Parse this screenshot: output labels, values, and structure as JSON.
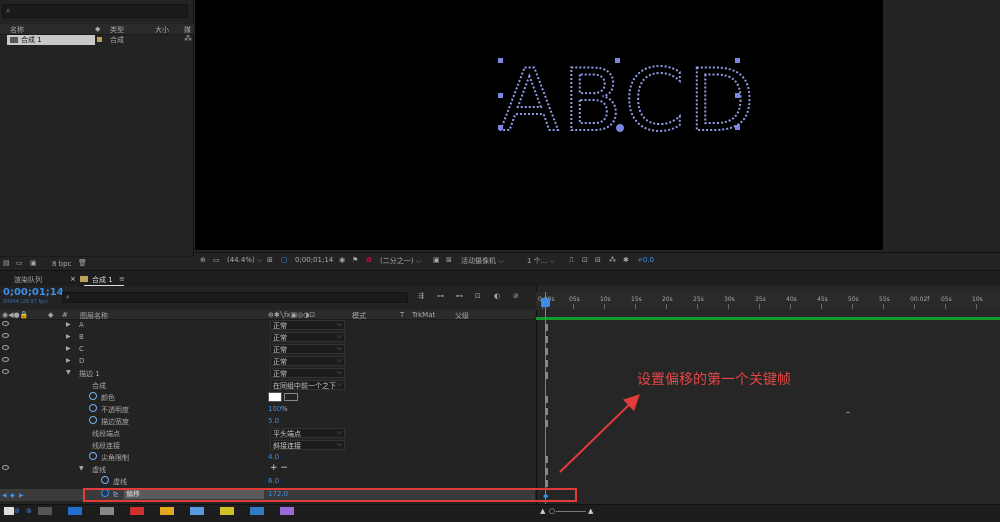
{
  "project": {
    "search_icon": "search-icon",
    "columns": {
      "name": "名称",
      "type": "类型",
      "size": "大小",
      "frame": "媒"
    },
    "item": {
      "name": "合成 1",
      "type": "合成"
    },
    "bpc": "8 bpc"
  },
  "viewer": {
    "zoom": "(44.4%)",
    "timecode": "0;00;01;14",
    "resolution": "(二分之一)",
    "camera": "活动摄像机",
    "views": "1 个...",
    "exposure": "+0.0",
    "letters": "ABCD"
  },
  "timeline": {
    "tab_render": "渲染队列",
    "tab_comp": "合成 1",
    "timecode": "0;00;01;14",
    "fps": "00044 (29.97 fps)",
    "columns": {
      "layer_name": "图层名称",
      "mode": "模式",
      "t": "T",
      "trkmat": "TrkMat",
      "parent": "父级"
    },
    "rows": [
      {
        "name": "A",
        "mode": "正常"
      },
      {
        "name": "B",
        "mode": "正常"
      },
      {
        "name": "C",
        "mode": "正常"
      },
      {
        "name": "D",
        "mode": "正常"
      },
      {
        "name": "描边 1",
        "mode": "正常"
      },
      {
        "name": "合成",
        "mode": "在同组中前一个之下"
      },
      {
        "name": "颜色"
      },
      {
        "name": "不透明度",
        "value": "100",
        "unit": "%"
      },
      {
        "name": "描边宽度",
        "value": "5.0"
      },
      {
        "name": "线段端点",
        "mode": "平头端点"
      },
      {
        "name": "线段连接",
        "mode": "斜接连接"
      },
      {
        "name": "尖角限制",
        "value": "4.0"
      },
      {
        "name": "虚线",
        "plusminus": "+ −"
      },
      {
        "name": "虚线",
        "value": "6.0"
      },
      {
        "name": "偏移",
        "value": "172.0"
      }
    ],
    "ruler": [
      "0:00s",
      "05s",
      "10s",
      "15s",
      "20s",
      "25s",
      "30s",
      "35s",
      "40s",
      "45s",
      "50s",
      "55s",
      "00:02f",
      "05s",
      "10s"
    ]
  },
  "annotation": {
    "text": "设置偏移的第一个关键帧"
  },
  "colors": {
    "accent": "#3b8fe6",
    "stroke": "#8e9be8",
    "annotation": "#e33a3a",
    "work_area": "#0f9a2c"
  }
}
